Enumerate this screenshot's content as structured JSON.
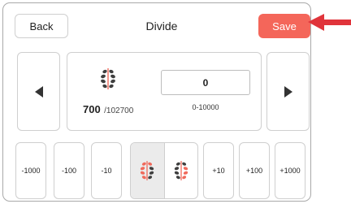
{
  "header": {
    "back_label": "Back",
    "title": "Divide",
    "save_label": "Save"
  },
  "item": {
    "count": "700",
    "total": "/102700"
  },
  "quantity": {
    "value": "0",
    "range": "0-10000"
  },
  "steppers": {
    "minus_1000": "-1000",
    "minus_100": "-100",
    "minus_10": "-10",
    "plus_10": "+10",
    "plus_100": "+100",
    "plus_1000": "+1000"
  },
  "colors": {
    "accent": "#f4665a",
    "annotation_arrow": "#e0343b",
    "seed_red": "#f06a5c",
    "seed_dark": "#3f3f3f"
  },
  "icons": {
    "item": "seed-pod-icon",
    "nav_prev": "triangle-left-icon",
    "nav_next": "triangle-right-icon"
  }
}
